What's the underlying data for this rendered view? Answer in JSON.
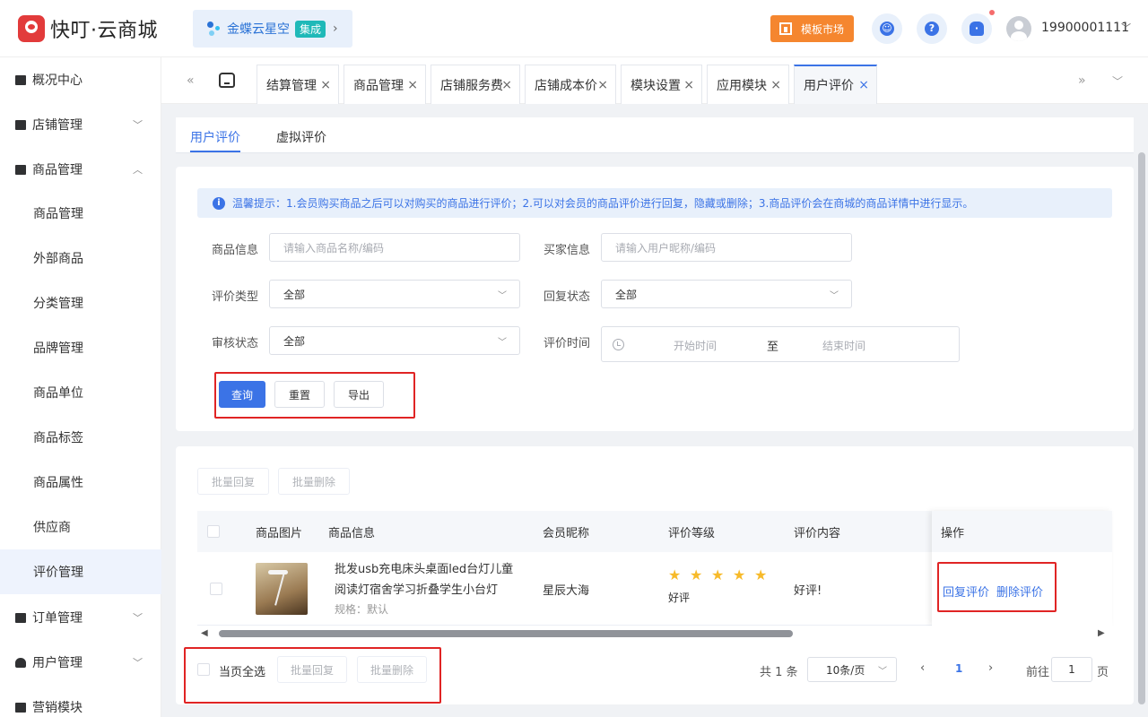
{
  "header": {
    "logo_text": "快叮·云商城",
    "kingdee_name": "金蝶云星空",
    "kingdee_tag": "集成",
    "template_market": "模板市场",
    "user_phone": "19900001111"
  },
  "sidebar": {
    "items": [
      {
        "label": "概况中心"
      },
      {
        "label": "店铺管理"
      },
      {
        "label": "商品管理"
      },
      {
        "label": "商品管理"
      },
      {
        "label": "外部商品"
      },
      {
        "label": "分类管理"
      },
      {
        "label": "品牌管理"
      },
      {
        "label": "商品单位"
      },
      {
        "label": "商品标签"
      },
      {
        "label": "商品属性"
      },
      {
        "label": "供应商"
      },
      {
        "label": "评价管理"
      },
      {
        "label": "订单管理"
      },
      {
        "label": "用户管理"
      },
      {
        "label": "营销模块"
      }
    ]
  },
  "tabs": [
    {
      "label": "结算管理"
    },
    {
      "label": "商品管理"
    },
    {
      "label": "店铺服务费"
    },
    {
      "label": "店铺成本价"
    },
    {
      "label": "模块设置"
    },
    {
      "label": "应用模块"
    },
    {
      "label": "用户评价"
    }
  ],
  "subtabs": {
    "user": "用户评价",
    "virtual": "虚拟评价"
  },
  "tip_text": "温馨提示：1.会员购买商品之后可以对购买的商品进行评价；2.可以对会员的商品评价进行回复，隐藏或删除；3.商品评价会在商城的商品详情中进行显示。",
  "filters": {
    "product_info_label": "商品信息",
    "product_info_placeholder": "请输入商品名称/编码",
    "buyer_info_label": "买家信息",
    "buyer_info_placeholder": "请输入用户昵称/编码",
    "review_type_label": "评价类型",
    "review_type_value": "全部",
    "reply_status_label": "回复状态",
    "reply_status_value": "全部",
    "audit_status_label": "审核状态",
    "audit_status_value": "全部",
    "review_time_label": "评价时间",
    "start_time": "开始时间",
    "to": "至",
    "end_time": "结束时间"
  },
  "buttons": {
    "query": "查询",
    "reset": "重置",
    "export": "导出",
    "batch_reply": "批量回复",
    "batch_delete": "批量删除",
    "select_page": "当页全选"
  },
  "table": {
    "headers": [
      "商品图片",
      "商品信息",
      "会员昵称",
      "评价等级",
      "评价内容",
      "操作"
    ],
    "rows": [
      {
        "name": "批发usb充电床头桌面led台灯儿童阅读灯宿舍学习折叠学生小台灯",
        "spec": "规格：默认",
        "member": "星辰大海",
        "rating": 5,
        "rating_text": "好评",
        "content": "好评!",
        "op_reply": "回复评价",
        "op_delete": "删除评价"
      }
    ]
  },
  "pager": {
    "total": "共 1 条",
    "page_size": "10条/页",
    "current": "1",
    "goto": "前往",
    "goto_value": "1",
    "page_unit": "页"
  },
  "colors": {
    "primary": "#3b73e6",
    "accent_orange": "#f5862f",
    "brand_red": "#e23b3b",
    "highlight_red": "#e02424"
  }
}
